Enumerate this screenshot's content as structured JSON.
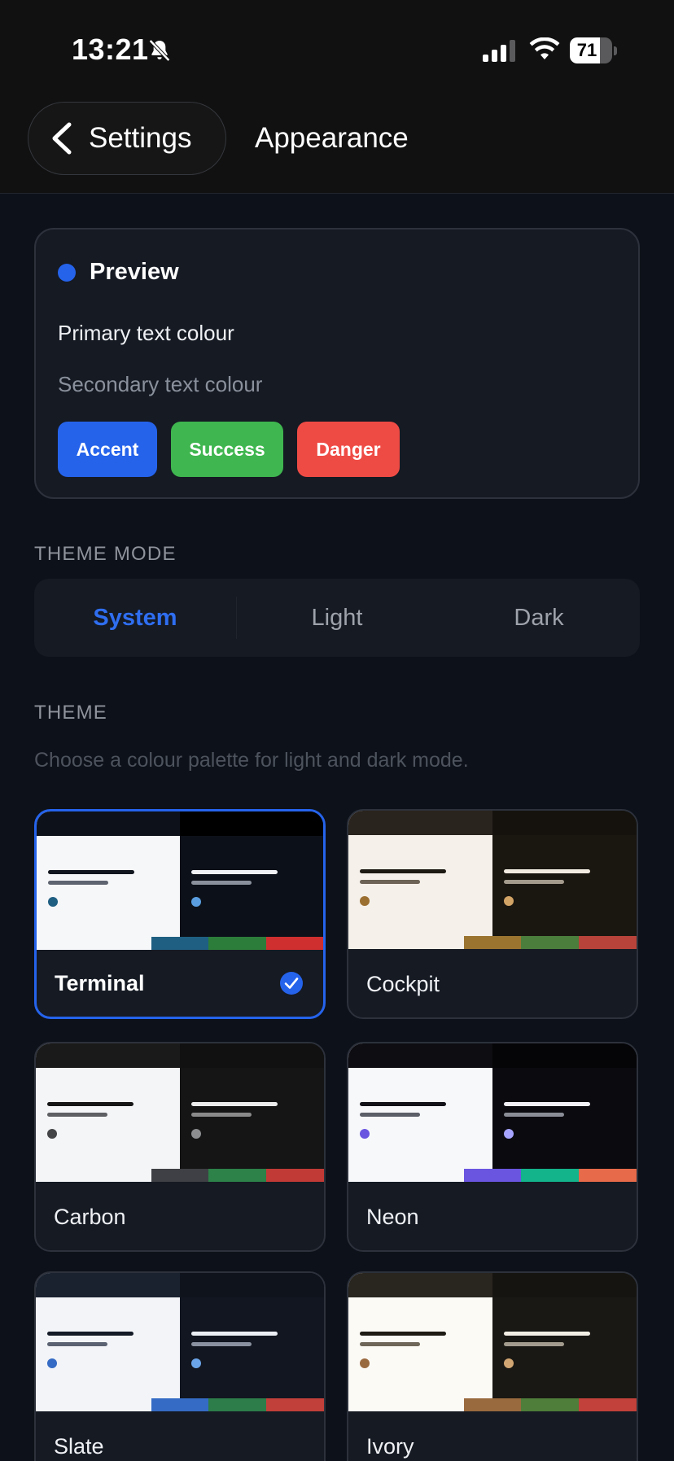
{
  "status_bar": {
    "time": "13:21",
    "battery": "71",
    "battery_level": 0.71
  },
  "nav": {
    "back_label": "Settings",
    "title": "Appearance"
  },
  "preview": {
    "title": "Preview",
    "primary_text": "Primary text colour",
    "secondary_text": "Secondary text colour",
    "buttons": [
      {
        "label": "Accent",
        "color": "#2563eb"
      },
      {
        "label": "Success",
        "color": "#3fb64f"
      },
      {
        "label": "Danger",
        "color": "#ef4b45"
      }
    ]
  },
  "theme_mode": {
    "heading": "THEME MODE",
    "options": [
      "System",
      "Light",
      "Dark"
    ],
    "selected": "System"
  },
  "theme": {
    "heading": "THEME",
    "description": "Choose a colour palette for light and dark mode.",
    "selected": "Terminal",
    "items": [
      {
        "name": "Terminal",
        "light_bg": "#f6f7f9",
        "dark_bg": "#0c1119",
        "light_strip": "#0d1119",
        "dark_strip": "#000000",
        "light_line": "#12161e",
        "light_line2": "#5e6470",
        "dark_line": "#eef0f4",
        "dark_line2": "#8b919c",
        "light_dot": "#1f5f82",
        "dark_dot": "#5a9ee0",
        "bars": [
          "#f6f7f9",
          "#1f5f82",
          "#2d7d3a",
          "#cf2f2f"
        ]
      },
      {
        "name": "Cockpit",
        "light_bg": "#f5f0e9",
        "dark_bg": "#1a1610",
        "light_strip": "#2a241e",
        "dark_strip": "#15120d",
        "light_line": "#1c1812",
        "light_line2": "#6d6356",
        "dark_line": "#f2ece2",
        "dark_line2": "#a59b8d",
        "light_dot": "#9b6f30",
        "dark_dot": "#d2a466",
        "bars": [
          "#f5f0e9",
          "#9b7430",
          "#4b7d3c",
          "#b8433a"
        ]
      },
      {
        "name": "Carbon",
        "light_bg": "#f4f5f7",
        "dark_bg": "#151515",
        "light_strip": "#1a1a1a",
        "dark_strip": "#111111",
        "light_line": "#161616",
        "light_line2": "#5d5f63",
        "dark_line": "#ececec",
        "dark_line2": "#8a8a8a",
        "light_dot": "#444546",
        "dark_dot": "#8d8e90",
        "bars": [
          "#f4f5f7",
          "#3e4045",
          "#2c8248",
          "#c23a36"
        ]
      },
      {
        "name": "Neon",
        "light_bg": "#f7f8fa",
        "dark_bg": "#0a0a0f",
        "light_strip": "#0d0d12",
        "dark_strip": "#050507",
        "light_line": "#121218",
        "light_line2": "#5c5e68",
        "dark_line": "#f0f0f5",
        "dark_line2": "#8a8c96",
        "light_dot": "#6a55e0",
        "dark_dot": "#a7a4ff",
        "bars": [
          "#f7f8fa",
          "#6a55e0",
          "#13b38b",
          "#e76a4a"
        ]
      },
      {
        "name": "Slate",
        "light_bg": "#f2f4f8",
        "dark_bg": "#121620",
        "light_strip": "#1a2230",
        "dark_strip": "#0f131c",
        "light_line": "#141a26",
        "light_line2": "#5b6272",
        "dark_line": "#eceff5",
        "dark_line2": "#8a91a0",
        "light_dot": "#356bc4",
        "dark_dot": "#6ba4e8",
        "bars": [
          "#f2f4f8",
          "#356bc4",
          "#2d7d4a",
          "#c2403a"
        ]
      },
      {
        "name": "Ivory",
        "light_bg": "#fcfaf5",
        "dark_bg": "#1a1814",
        "light_strip": "#29251f",
        "dark_strip": "#161410",
        "light_line": "#1e1a14",
        "light_line2": "#6e6658",
        "dark_line": "#f3efe6",
        "dark_line2": "#a39c8e",
        "light_dot": "#9a6a3f",
        "dark_dot": "#d2a672",
        "bars": [
          "#fcfaf5",
          "#9a6a3f",
          "#4f7d3a",
          "#c2413a"
        ]
      }
    ]
  }
}
